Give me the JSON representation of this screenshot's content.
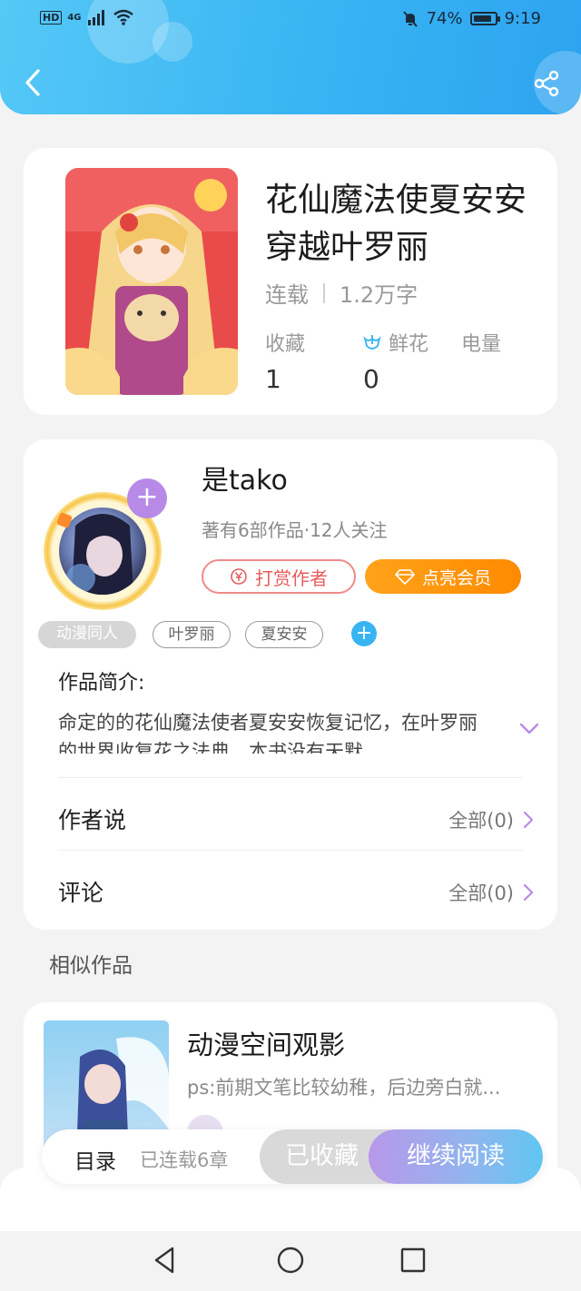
{
  "status_bar": {
    "left_badges": [
      "HD",
      "4G"
    ],
    "battery": "74%",
    "battery_level": 0.74,
    "time": "9:19"
  },
  "header": {
    "back_icon": "chevron-left-icon",
    "share_icon": "share-icon",
    "colors": {
      "gradient_start": "#55c8f6",
      "gradient_end": "#2ea3f0"
    }
  },
  "book": {
    "title": "花仙魔法使夏安安穿越叶罗丽",
    "status": "连载",
    "word_count": "1.2万字",
    "stats": [
      {
        "label": "收藏",
        "value": "1"
      },
      {
        "label": "鲜花",
        "value": "0",
        "icon": "flower-icon"
      },
      {
        "label": "电量",
        "value": ""
      }
    ]
  },
  "author": {
    "name": "是tako",
    "subtitle": "著有6部作品·12人关注",
    "reward_label": "打赏作者",
    "vip_label": "点亮会员"
  },
  "tags": [
    "动漫同人",
    "叶罗丽",
    "夏安安"
  ],
  "intro": {
    "heading": "作品简介:",
    "text": "命定的的花仙魔法使者夏安安恢复记忆，在叶罗丽的世界收复花之法典，本书没有天默"
  },
  "rows": [
    {
      "label": "作者说",
      "right": "全部(0)"
    },
    {
      "label": "评论",
      "right": "全部(0)"
    }
  ],
  "similar": {
    "heading": "相似作品",
    "items": [
      {
        "title": "动漫空间观影",
        "desc": "ps:前期文笔比较幼稚，后边旁白就..."
      }
    ]
  },
  "bottom_bar": {
    "toc_label": "目录",
    "toc_sub": "已连载6章",
    "fav_label": "已收藏",
    "read_label": "继续阅读"
  },
  "accent_colors": {
    "purple": "#b78ae8",
    "orange": "#ff8a00",
    "red": "#e65c5c",
    "blue": "#38b4f3"
  }
}
